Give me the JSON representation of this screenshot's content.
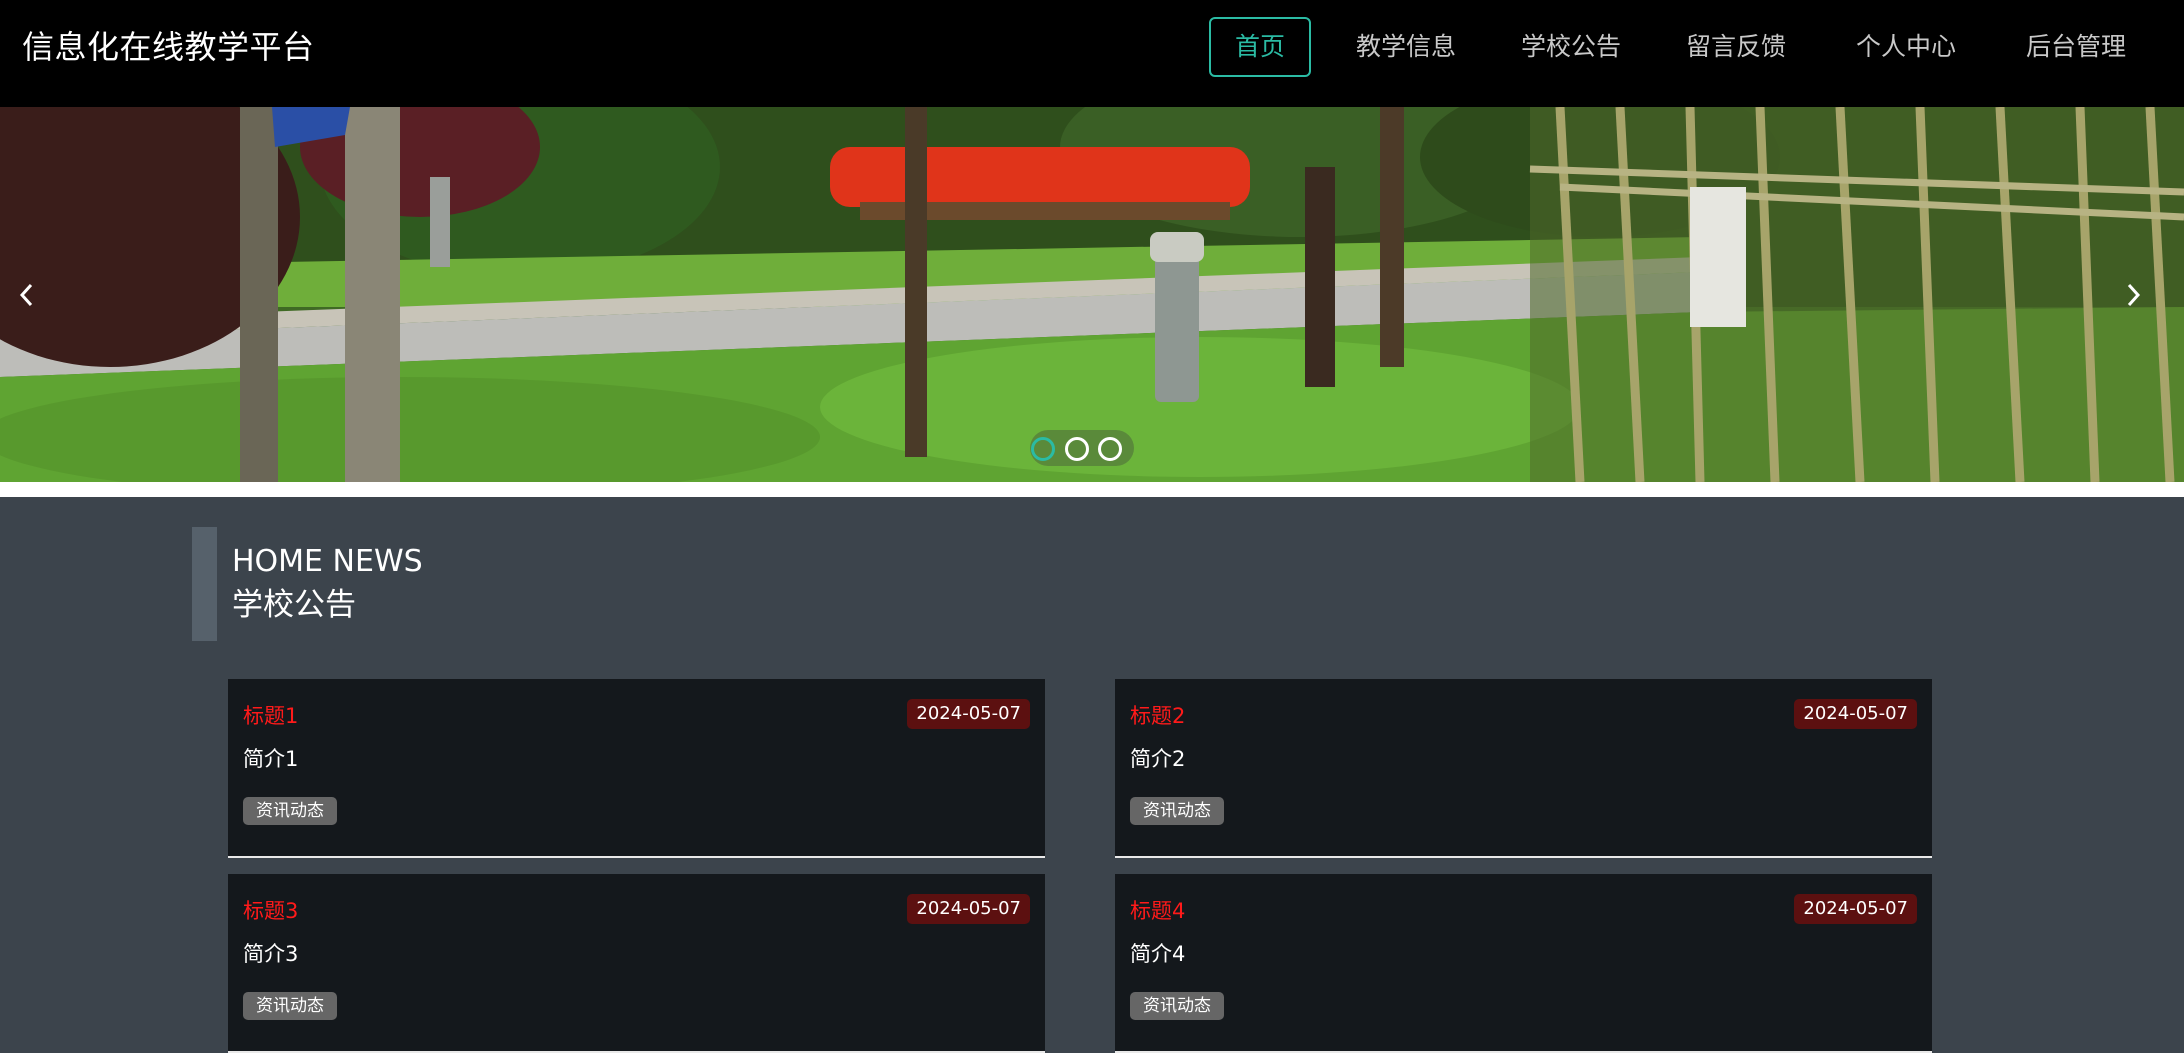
{
  "header": {
    "brand": "信息化在线教学平台",
    "nav": [
      {
        "label": "首页",
        "active": true
      },
      {
        "label": "教学信息",
        "active": false
      },
      {
        "label": "学校公告",
        "active": false
      },
      {
        "label": "留言反馈",
        "active": false
      },
      {
        "label": "个人中心",
        "active": false
      },
      {
        "label": "后台管理",
        "active": false
      }
    ]
  },
  "carousel": {
    "slide_count": 3,
    "active_slide": 1
  },
  "section": {
    "title_en": "HOME NEWS",
    "title_cn": "学校公告"
  },
  "news": [
    {
      "title": "标题1",
      "date": "2024-05-07",
      "summary": "简介1",
      "tag": "资讯动态"
    },
    {
      "title": "标题2",
      "date": "2024-05-07",
      "summary": "简介2",
      "tag": "资讯动态"
    },
    {
      "title": "标题3",
      "date": "2024-05-07",
      "summary": "简介3",
      "tag": "资讯动态"
    },
    {
      "title": "标题4",
      "date": "2024-05-07",
      "summary": "简介4",
      "tag": "资讯动态"
    }
  ],
  "colors": {
    "accent": "#2bbba4",
    "header_bg": "#000000",
    "page_bg": "#3c444c",
    "card_bg": "#14181c",
    "news_title": "#ff1a1a",
    "date_badge": "#5c1010"
  }
}
